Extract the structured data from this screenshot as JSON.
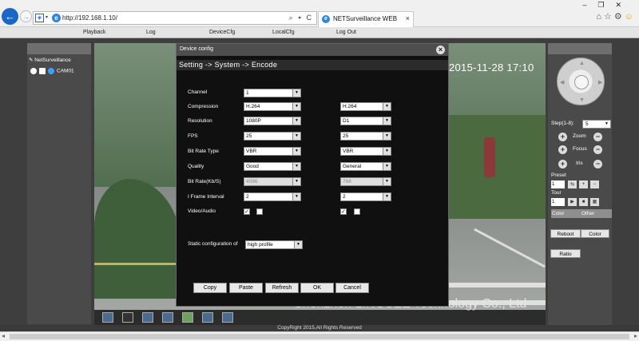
{
  "browser": {
    "url": "http://192.168.1.10/",
    "tab_title": "NETSurveillance WEB",
    "back_glyph": "←",
    "fwd_glyph": "→",
    "search_glyph": "⌕ ▾ C",
    "tab_close": "×",
    "winctl": "–❐✕",
    "tools": "⌂☆⚙",
    "smiley": "☺",
    "colors": {
      "back_button": "#1a67c8"
    }
  },
  "menu": [
    "Playback",
    "Log",
    "DeviceCfg",
    "LocalCfg",
    "Log Out"
  ],
  "left_panel": {
    "root": "NetSurveillance",
    "camera": "CAM01"
  },
  "video": {
    "timestamp": "2015-11-28  17:10",
    "watermark": "Shenzhen LINGSEE Technology Co., Ltd"
  },
  "dialog": {
    "title": "Device config",
    "close": "×",
    "breadcrumb": "Setting -> System -> Encode",
    "rows": [
      {
        "label": "Channel",
        "main": "1",
        "extra": ""
      },
      {
        "label": "Compression",
        "main": "H.264",
        "extra": "H.264"
      },
      {
        "label": "Resolution",
        "main": "1080P",
        "extra": "D1"
      },
      {
        "label": "FPS",
        "main": "25",
        "extra": "25"
      },
      {
        "label": "Bit Rate Type",
        "main": "VBR",
        "extra": "VBR"
      },
      {
        "label": "Quality",
        "main": "Good",
        "extra": "General"
      },
      {
        "label": "Bit Rate(Kb/S)",
        "main": "4096",
        "extra": "768"
      },
      {
        "label": "I Frame Interval",
        "main": "2",
        "extra": "2"
      },
      {
        "label": "Video/Audio",
        "main": "",
        "extra": ""
      }
    ],
    "checks": {
      "main_video": "✓",
      "extra_video": "✓"
    },
    "static_label": "Static configuration of",
    "static_value": "high profile",
    "buttons": [
      "Copy",
      "Paste",
      "Refresh",
      "OK",
      "Cancel"
    ],
    "select_arrow": "▼"
  },
  "right_panel": {
    "step_label": "Step(1-8):",
    "step_value": "5",
    "zoom": "Zoom",
    "focus": "Focus",
    "iris": "Iris",
    "plus": "+",
    "minus": "−",
    "preset_label": "Preset",
    "preset_value": "1",
    "tour_label": "Tour",
    "tour_value": "1",
    "tab_color": "Color",
    "tab_other": "Other",
    "btn_reboot": "Reboot",
    "btn_color": "Color",
    "btn_ratio": "Ratio",
    "arrows": {
      "up": "▲",
      "down": "▼",
      "left": "◀",
      "right": "▶"
    },
    "mini_preset": [
      "⇆",
      "+",
      "−"
    ],
    "mini_tour": [
      "▶",
      "■",
      "▦"
    ]
  },
  "footer": {
    "copyright": "CopyRight 2015,All Rights Reserved",
    "scroll_left": "◂",
    "scroll_right": "▸"
  }
}
